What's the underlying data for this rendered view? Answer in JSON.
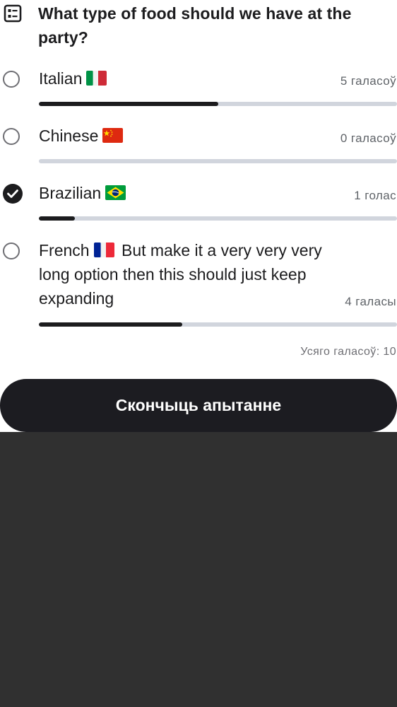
{
  "poll": {
    "question": "What type of food should we have at the party?",
    "icon": "poll-list-icon",
    "options": [
      {
        "label": "Italian",
        "flag": "italy-flag-icon",
        "votes": "5 галасоў",
        "vote_fraction": 0.5,
        "selected": false
      },
      {
        "label": "Chinese",
        "flag": "china-flag-icon",
        "votes": "0 галасоў",
        "vote_fraction": 0,
        "selected": false
      },
      {
        "label": "Brazilian",
        "flag": "brazil-flag-icon",
        "votes": "1 голас",
        "vote_fraction": 0.1,
        "selected": true
      },
      {
        "label_before_flag": "French",
        "label_after_flag": "But make it a very very very long option then this should just keep expanding",
        "flag": "france-flag-icon",
        "votes": "4 галасы",
        "vote_fraction": 0.4,
        "selected": false
      }
    ],
    "total_votes": "Усяго галасоў: 10",
    "end_poll_label": "Скончыць апытанне"
  },
  "colors": {
    "card_background": "#ffffff",
    "page_background": "#303030",
    "text": "#1c1c1e",
    "muted_text": "#5f6368",
    "bar_track": "#d1d5dd",
    "bar_fill": "#1c1c1e",
    "button_background": "#1c1c21",
    "button_text": "#ffffff"
  }
}
